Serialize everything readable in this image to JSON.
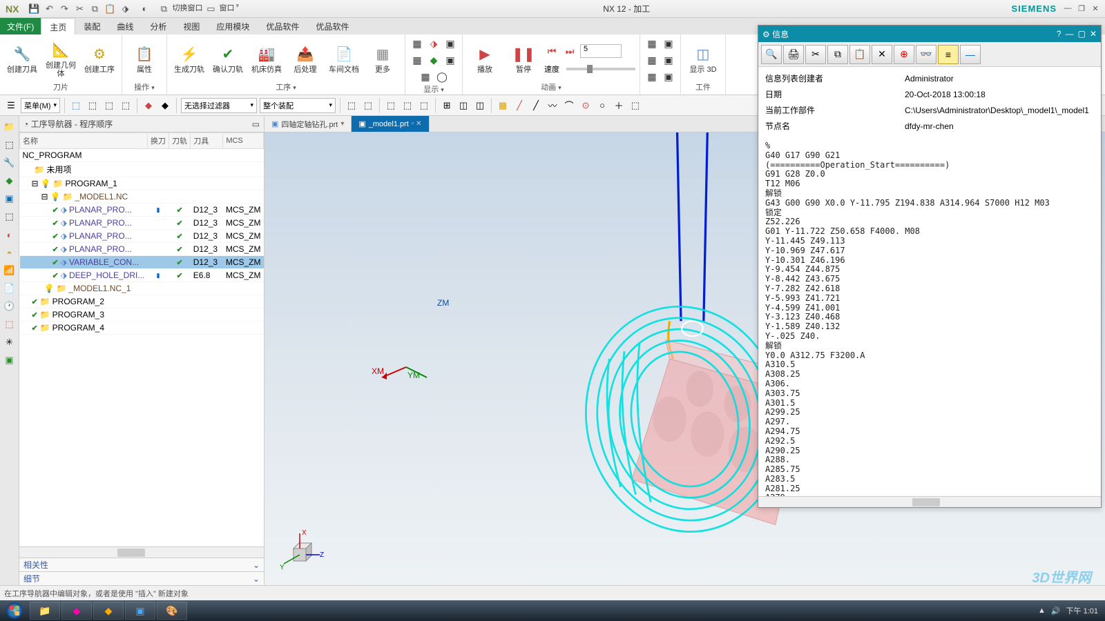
{
  "titlebar": {
    "logo": "NX",
    "qat_tips": [
      "save",
      "undo",
      "redo",
      "cut",
      "copy",
      "paste",
      "prop"
    ],
    "mid_items": [
      "切换窗口",
      "窗口"
    ],
    "title": "NX 12 - 加工",
    "brand": "SIEMENS"
  },
  "ribbon_tabs": {
    "file": "文件(F)",
    "tabs": [
      "主页",
      "装配",
      "曲线",
      "分析",
      "视图",
      "应用模块",
      "优品软件",
      "优品软件"
    ],
    "active_index": 0
  },
  "ribbon": {
    "g1": {
      "btns": [
        "创建刀具",
        "创建几何体",
        "创建工序"
      ],
      "label": "刀片"
    },
    "g2": {
      "btns": [
        "属性"
      ],
      "label": "操作"
    },
    "g3": {
      "btns": [
        "生成刀轨",
        "确认刀轨",
        "机床仿真",
        "后处理",
        "车间文档",
        "更多"
      ],
      "label": "工序"
    },
    "g4": {
      "label": "显示"
    },
    "g5": {
      "btns": [
        "播放",
        "暂停"
      ],
      "label": "动画",
      "speed_label": "速度",
      "spin": "5"
    },
    "g6": {
      "btns": [
        "显示 3D"
      ],
      "label": "工件"
    }
  },
  "toolbar2": {
    "menu": "菜单(M)",
    "filter1": "无选择过滤器",
    "filter2": "整个装配"
  },
  "nav": {
    "title": "工序导航器 - 程序顺序",
    "cols": [
      "名称",
      "换刀",
      "刀轨",
      "刀具",
      "MCS"
    ],
    "root": "NC_PROGRAM",
    "unused": "未用项",
    "programs": [
      "PROGRAM_1",
      "PROGRAM_2",
      "PROGRAM_3",
      "PROGRAM_4"
    ],
    "p1_nc": "_MODEL1.NC",
    "p1_nc2": "_MODEL1.NC_1",
    "ops": [
      {
        "n": "PLANAR_PRO...",
        "t": "D12_3",
        "m": "MCS_ZM",
        "tc": "▮"
      },
      {
        "n": "PLANAR_PRO...",
        "t": "D12_3",
        "m": "MCS_ZM",
        "tc": ""
      },
      {
        "n": "PLANAR_PRO...",
        "t": "D12_3",
        "m": "MCS_ZM",
        "tc": ""
      },
      {
        "n": "PLANAR_PRO...",
        "t": "D12_3",
        "m": "MCS_ZM",
        "tc": ""
      },
      {
        "n": "VARIABLE_CON...",
        "t": "D12_3",
        "m": "MCS_ZM",
        "tc": "",
        "sel": true
      },
      {
        "n": "DEEP_HOLE_DRI...",
        "t": "E6.8",
        "m": "MCS_ZM",
        "tc": "▮"
      }
    ],
    "sec1": "相关性",
    "sec2": "细节"
  },
  "view_tabs": [
    {
      "label": "四轴定轴钻孔.prt",
      "active": false
    },
    {
      "label": "_model1.prt",
      "active": true
    }
  ],
  "info": {
    "title": "信息",
    "meta": [
      {
        "k": "信息列表创建者",
        "v": "Administrator"
      },
      {
        "k": "日期",
        "v": "20-Oct-2018 13:00:18"
      },
      {
        "k": "当前工作部件",
        "v": "C:\\Users\\Administrator\\Desktop\\_model1\\_model1"
      },
      {
        "k": "节点名",
        "v": "dfdy-mr-chen"
      }
    ],
    "body": "%\nG40 G17 G90 G21\n(==========Operation_Start==========)\nG91 G28 Z0.0\nT12 M06\n解锁\nG43 G00 G90 X0.0 Y-11.795 Z194.838 A314.964 S7000 H12 M03\n锁定\nZ52.226\nG01 Y-11.722 Z50.658 F4000. M08\nY-11.445 Z49.113\nY-10.969 Z47.617\nY-10.301 Z46.196\nY-9.454 Z44.875\nY-8.442 Z43.675\nY-7.282 Z42.618\nY-5.993 Z41.721\nY-4.599 Z41.001\nY-3.123 Z40.468\nY-1.589 Z40.132\nY-.025 Z40.\n解锁\nY0.0 A312.75 F3200.A\nA310.5\nA308.25\nA306.\nA303.75\nA301.5\nA299.25\nA297.\nA294.75\nA292.5\nA290.25\nA288.\nA285.75\nA283.5\nA281.25\nA279"
  },
  "status": "在工序导航器中编辑对象，或者是使用 \"插入\" 新建对象",
  "watermark": "3D世界网",
  "taskbar": {
    "time": "下午 1:01"
  },
  "axes": {
    "x": "X",
    "y": "Y",
    "z": "Z",
    "xm": "XM",
    "ym": "YM",
    "zm": "ZM"
  }
}
